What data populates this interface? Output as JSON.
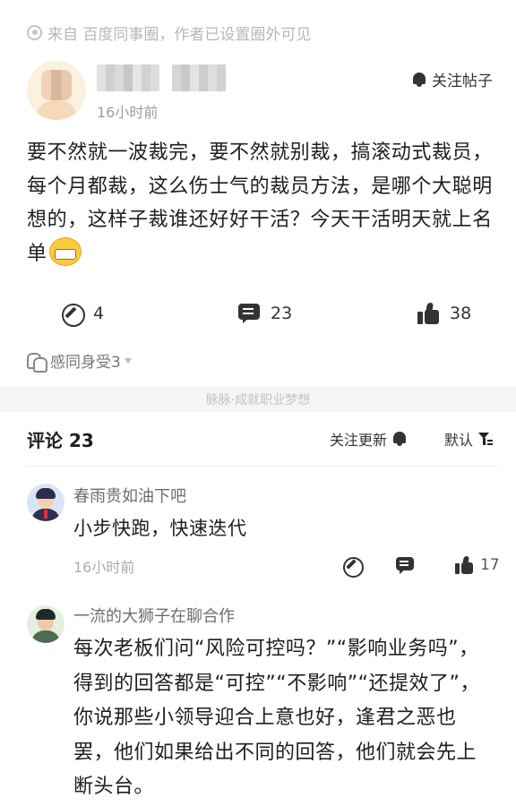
{
  "source": {
    "text": "来自 百度同事圈，作者已设置圈外可见"
  },
  "post": {
    "time": "16小时前",
    "follow_label": "关注帖子",
    "body": "要不然就一波裁完，要不然就别裁，搞滚动式裁员，每个月都裁，这么伤士气的裁员方法，是哪个大聪明想的，这样子裁谁还好好干活？今天干活明天就上名单",
    "repost_count": "4",
    "comment_count": "23",
    "like_count": "38",
    "reaction_label": "感同身受3"
  },
  "divider": {
    "text": "脉脉·成就职业梦想"
  },
  "comments_header": {
    "title": "评论 23",
    "follow_updates": "关注更新",
    "sort_label": "默认"
  },
  "comments": [
    {
      "author": "春雨贵如油下吧",
      "text": "小步快跑，快速迭代",
      "time": "16小时前",
      "like_count": "17"
    },
    {
      "author": "一流的大狮子在聊合作",
      "text": "每次老板们问“风险可控吗？”“影响业务吗”，得到的回答都是“可控”“不影响”“还提效了”，你说那些小领导迎合上意也好，逢君之恶也罢，他们如果给出不同的回答，他们就会先上断头台。"
    }
  ]
}
